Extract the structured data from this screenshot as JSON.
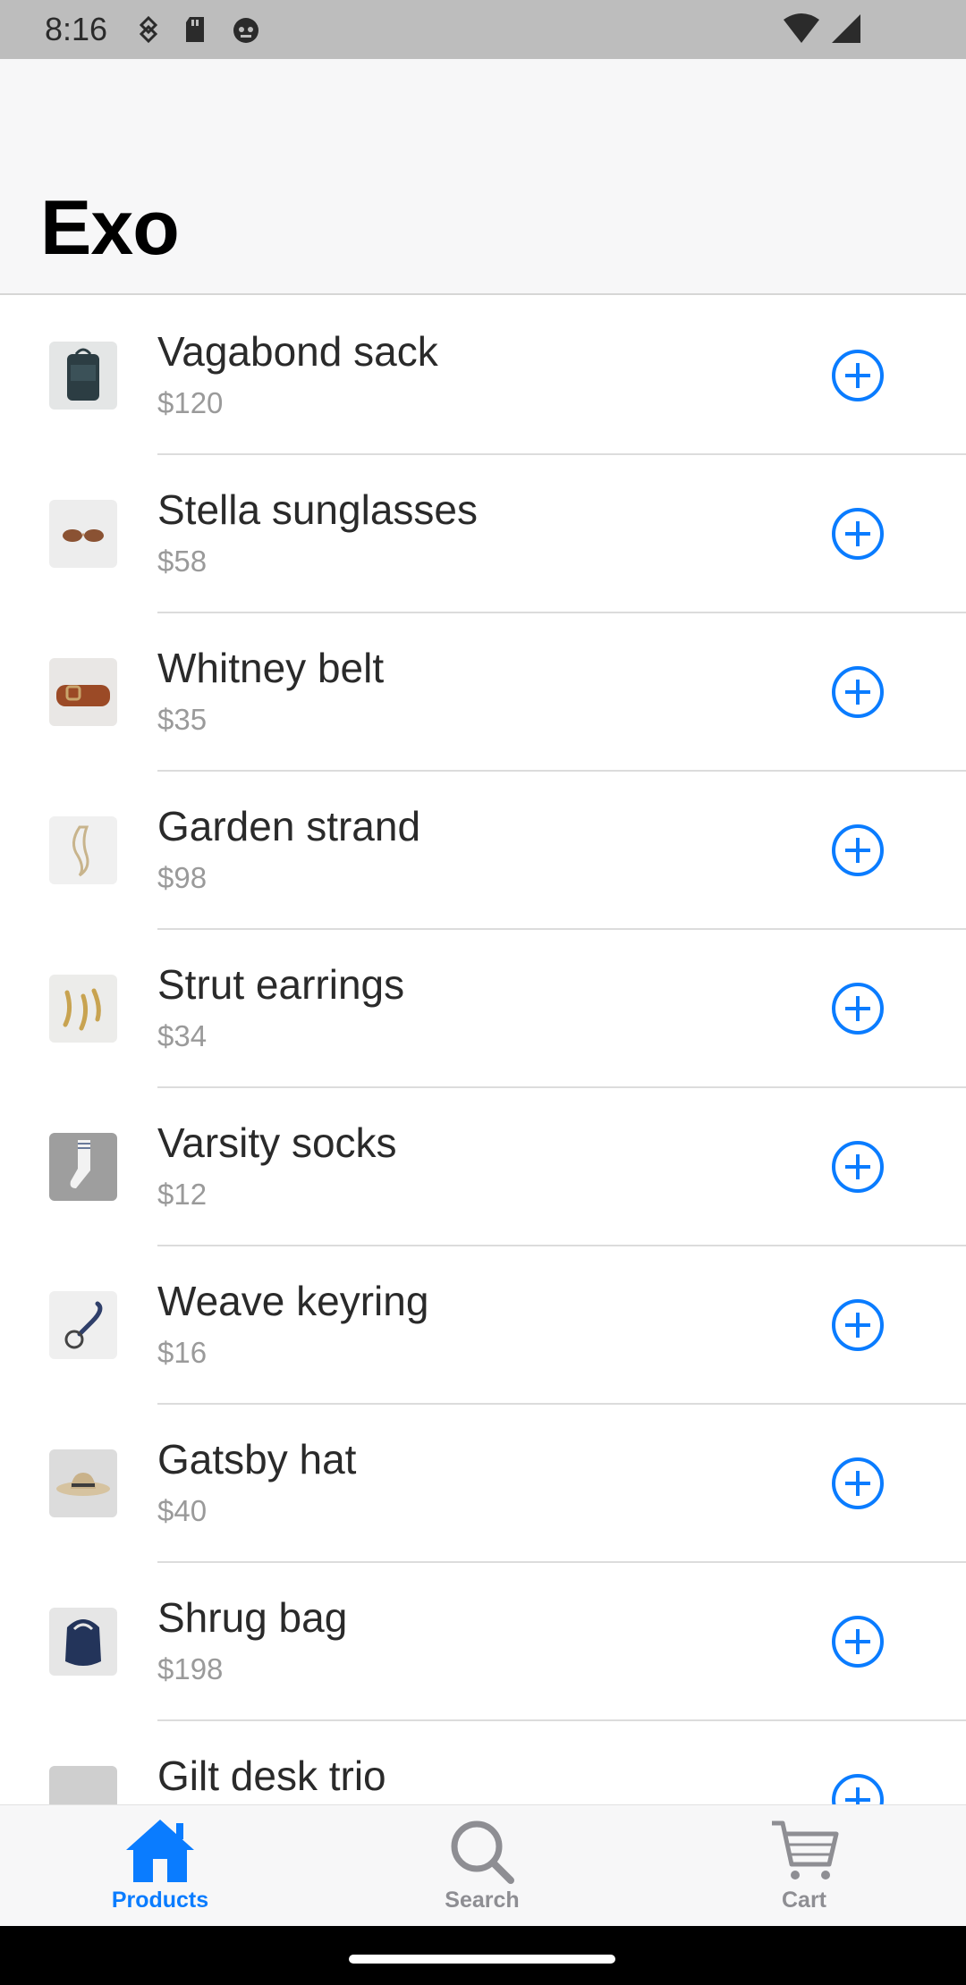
{
  "status_bar": {
    "time": "8:16"
  },
  "header": {
    "title": "Exo"
  },
  "products": [
    {
      "name": "Vagabond sack",
      "price": "$120",
      "thumb": "backpack"
    },
    {
      "name": "Stella sunglasses",
      "price": "$58",
      "thumb": "sunglasses"
    },
    {
      "name": "Whitney belt",
      "price": "$35",
      "thumb": "belt"
    },
    {
      "name": "Garden strand",
      "price": "$98",
      "thumb": "necklace"
    },
    {
      "name": "Strut earrings",
      "price": "$34",
      "thumb": "earrings"
    },
    {
      "name": "Varsity socks",
      "price": "$12",
      "thumb": "socks"
    },
    {
      "name": "Weave keyring",
      "price": "$16",
      "thumb": "keyring"
    },
    {
      "name": "Gatsby hat",
      "price": "$40",
      "thumb": "hat"
    },
    {
      "name": "Shrug bag",
      "price": "$198",
      "thumb": "bag"
    },
    {
      "name": "Gilt desk trio",
      "price": "",
      "thumb": "desk-trio"
    }
  ],
  "tabs": [
    {
      "label": "Products",
      "icon": "home-icon",
      "active": true
    },
    {
      "label": "Search",
      "icon": "search-icon",
      "active": false
    },
    {
      "label": "Cart",
      "icon": "cart-icon",
      "active": false
    }
  ],
  "colors": {
    "accent": "#0a7cff",
    "inactive": "#8e8e93"
  }
}
